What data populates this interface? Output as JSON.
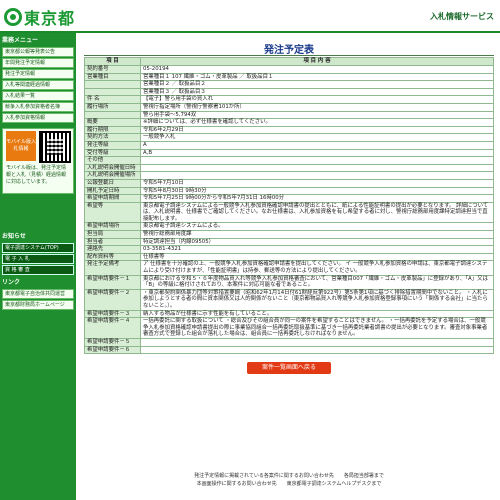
{
  "header": {
    "logo_text": "東京都",
    "service": "入札情報サービス"
  },
  "sidebar": {
    "head1": "業務メニュー",
    "items": [
      "東京都公報等発表公告",
      "年間発注予定情報",
      "発注予定情報",
      "入札等関連経過情報",
      "入札結果一覧",
      "競争入札参加資格者名簿",
      "入札参加資格情報"
    ],
    "mobile_img": "モバイル版入札情報",
    "mobile_text": "モバイル版は、発注予定情報と入札（見積）経過情報に対応しています。",
    "head2": "お知らせ",
    "dark": [
      "電子調達システム(TOP)",
      "電 子 入 札",
      "資 格 審 査"
    ],
    "head3": "リンク",
    "links": [
      "東京都電子自治体共同運営",
      "東京都財務局ホームページ"
    ]
  },
  "title": "発注予定表",
  "col_item": "項 目",
  "col_content": "項 目 内 容",
  "rows": [
    {
      "k": "契約番号",
      "v": "05-20194"
    },
    {
      "k": "営業種目",
      "v": "営業種目１ 107 繊維・ゴム・皮革製品 ／ 取扱品目１"
    },
    {
      "k": "",
      "v": "営業種目２ ／ 取扱品目２"
    },
    {
      "k": "",
      "v": "営業種目３ ／ 取扱品目３"
    },
    {
      "k": "件 名",
      "v": "【電子】警ら用手袋の買入れ"
    },
    {
      "k": "履行場所",
      "v": "警視庁指定場所（警視庁警察署101か所）"
    },
    {
      "k": "",
      "v": "警ら用手袋～5,794双"
    },
    {
      "k": "概要",
      "v": "※詳細については、必ず仕様書を確認してください。"
    },
    {
      "k": "履行期限",
      "v": "令和6年2月29日"
    },
    {
      "k": "契約方法",
      "v": "一般競争入札"
    },
    {
      "k": "発注等級",
      "v": "A"
    },
    {
      "k": "受付等級",
      "v": "A,B"
    },
    {
      "k": "その他",
      "v": ""
    },
    {
      "k": "入札説明会開催日時",
      "v": ""
    },
    {
      "k": "入札説明会開催場所",
      "v": ""
    },
    {
      "k": "公報登載日",
      "v": "令和5年7月10日"
    },
    {
      "k": "開札予定日時",
      "v": "令和5年8月30日 9時30分"
    },
    {
      "k": "希望申請期間",
      "v": "令和5年7月25日 9時00分から令和5年7月31日 16時00分"
    },
    {
      "k": "希望等",
      "v": "東京都電子調達システムによる一般競争入札参加資格確認申請書の提出とともに、紙による性能証明書の提出が必要となります。 詳細については、入札説明書、仕様書でご確認してください。なお仕様書は、入札参加資格を有し希望する者に対し、警視庁総務部用度課特定調達担当で直接配布します。"
    },
    {
      "k": "希望申請場所",
      "v": "東京都電子調達システムによる。"
    },
    {
      "k": "担当局",
      "v": "警視庁総務部用度課"
    },
    {
      "k": "担当者",
      "v": "特定調達担当（内線09505）"
    },
    {
      "k": "連絡先",
      "v": "03-3581-4321"
    },
    {
      "k": "配布資料等",
      "v": "仕様書等"
    },
    {
      "k": "発注予定備考",
      "v": "ア 仕様書を十分確認の上、一般競争入札参加資格確認申請書を提出してください。 イ 一般競争入札参加資格の申請は、東京都電子調達システムにより受け付けますが、「性能証明書」は持参、郵送等の方法により提出してください。"
    },
    {
      "k": "希望申請要件－１",
      "v": "東京都における令和５・６年度物品買入れ等競争入札参加資格審査において、営業種目007「繊維・ゴム・皮革製品」に登録があり、「A」又は「B」の等級に格付けされており、本案件に対応可能な者であること。"
    },
    {
      "k": "希望申請要件－２",
      "v": "・東京都契約関係暴力団等対策措置要綱（昭和62年1月14日付61財経庶第922号）第5条第1項に基づく排除措置期間中でないこと。 ・入札に参加しようとする者の間に資本関係又は人的関係がないこと（東京都物品買入れ等競争入札参加資格登録事項にいう「関係する会社」に当たらないこと。）。"
    },
    {
      "k": "希望申請要件－３",
      "v": "納入する物品が仕様書に示す性能を有していること。"
    },
    {
      "k": "希望申請要件－４",
      "v": "一括再委託に関する取扱について ・総合及びその組合員が同一の案件を希望することはできません。 ・一括再委託を予定する場合は、一般競争入札参加資格確認申請書提出の際に事業協同組合一括再委託取扱基準に基づき一括再委託業者調書の提出が必要となります。審査対象事業者審査方式で登録した組合が落札した場合は、組合員に一括再委託しなければなりません。"
    },
    {
      "k": "希望申請要件－５",
      "v": ""
    },
    {
      "k": "希望申請要件－６",
      "v": ""
    }
  ],
  "back_button": "案件一覧画面へ戻る",
  "footer1": "発注予定情報に掲載されている各案件に関するお問い合わせ先　　各局担当部署まで",
  "footer2": "本画面操作に関するお問い合わせ先　　東京都電子調達システムヘルプデスクまで"
}
